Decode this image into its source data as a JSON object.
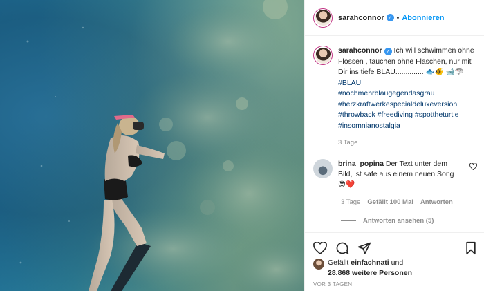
{
  "header": {
    "username": "sarahconnor",
    "separator": "•",
    "follow_label": "Abonnieren"
  },
  "caption": {
    "username": "sarahconnor",
    "text": "Ich will schwimmen ohne Flossen , tauchen ohne Flaschen, nur mit Dir ins tiefe BLAU.............. 🐟🐠 🐋🦈",
    "hashtags": [
      "#BLAU",
      "#nochmehrblaugegendasgrau",
      "#herzkraftwerkespecialdeluxeversion",
      "#throwback #freediving #spottheturtle",
      "#insomnianostalgia"
    ],
    "time": "3 Tage"
  },
  "comment": {
    "username": "brina_popina",
    "text": "Der Text unter dem Bild, ist safe aus einem neuen Song 😍❤️",
    "time": "3 Tage",
    "likes": "Gefällt 100 Mal",
    "reply_label": "Antworten",
    "view_replies": "Antworten ansehen (5)"
  },
  "likes": {
    "prefix": "Gefällt",
    "user": "einfachnati",
    "connector": "und",
    "others": "28.868 weitere Personen"
  },
  "timestamp": "VOR 3 TAGEN",
  "icons": {
    "verified": "verified-badge-icon",
    "like": "heart-icon",
    "comment": "comment-bubble-icon",
    "share": "paper-plane-icon",
    "save": "bookmark-icon",
    "comment_like": "small-heart-icon"
  },
  "colors": {
    "link": "#0095f6",
    "hashtag": "#00376b",
    "muted": "#8e8e8e",
    "verified": "#3897f0"
  }
}
